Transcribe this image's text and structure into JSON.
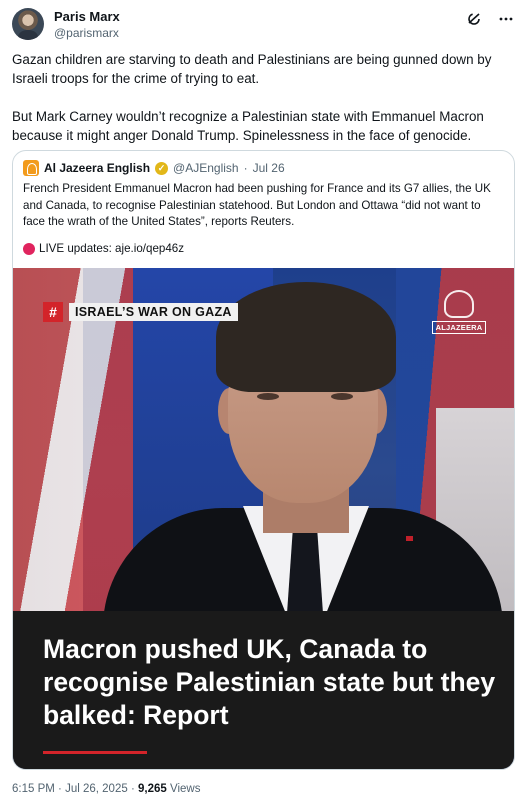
{
  "author": {
    "name": "Paris Marx",
    "handle": "@parismarx"
  },
  "header_icons": [
    "grok-icon",
    "more-icon"
  ],
  "tweet": {
    "paragraph_1": "Gazan children are starving to death and Palestinians are being gunned down by Israeli troops for the crime of trying to eat.",
    "paragraph_2": "But Mark Carney wouldn’t recognize a Palestinian state with Emmanuel Macron because it might anger Donald Trump. Spinelessness in the face of genocide."
  },
  "quote": {
    "name": "Al Jazeera English",
    "handle": "@AJEnglish",
    "date": "Jul 26",
    "separator": "·",
    "text": "French President Emmanuel Macron had been pushing for France and its G7 allies, the UK and Canada, to recognise Palestinian statehood. But London and Ottawa “did not want to face the wrath of the United States”, reports Reuters.",
    "live_text": "LIVE updates: aje.io/qep46z",
    "media": {
      "badge_hash": "#",
      "badge_text": "ISRAEL’S WAR ON GAZA",
      "logo_text": "ALJAZEERA",
      "headline": "Macron pushed UK, Canada to recognise Palestinian state but they balked: Report"
    }
  },
  "footer": {
    "time": "6:15 PM",
    "date": "Jul 26, 2025",
    "separator": "·",
    "views_count": "9,265",
    "views_label": "Views"
  }
}
